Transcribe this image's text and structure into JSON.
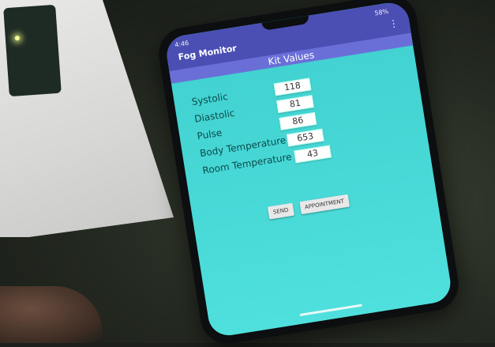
{
  "status_bar": {
    "time": "4:46",
    "battery": "58%"
  },
  "app": {
    "title": "Fog Monitor",
    "menu_icon": "more-vert-icon"
  },
  "kit_header": "Kit Values",
  "fields": [
    {
      "label": "Systolic",
      "value": "118"
    },
    {
      "label": "Diastolic",
      "value": "81"
    },
    {
      "label": "Pulse",
      "value": "86"
    },
    {
      "label": "Body Temperature",
      "value": "653"
    },
    {
      "label": "Room Temperature",
      "value": "43"
    }
  ],
  "buttons": {
    "send": "SEND",
    "appointment": "APPOINTMENT"
  },
  "colors": {
    "app_bar": "#4b4fb4",
    "header": "#6a6fd8",
    "screen": "#4fe0dd"
  }
}
